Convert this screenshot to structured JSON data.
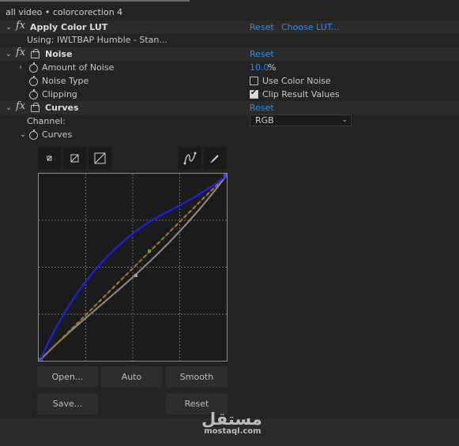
{
  "panel_title": "all video • colorcorection 4",
  "effects": {
    "apply_lut": {
      "name": "Apply Color LUT",
      "reset": "Reset",
      "choose": "Choose LUT...",
      "using": "Using: IWLTBAP Humble - Stan..."
    },
    "noise": {
      "name": "Noise",
      "reset": "Reset",
      "amount_label": "Amount of Noise",
      "amount_value": "10.0",
      "amount_unit": "%",
      "type_label": "Noise Type",
      "color_noise_label": "Use Color Noise",
      "color_noise_checked": false,
      "clipping_label": "Clipping",
      "clip_label": "Clip Result Values",
      "clip_checked": true
    },
    "curves": {
      "name": "Curves",
      "reset": "Reset",
      "channel_label": "Channel:",
      "channel_value": "RGB",
      "curves_label": "Curves",
      "buttons": {
        "open": "Open...",
        "auto": "Auto",
        "smooth": "Smooth",
        "save": "Save...",
        "reset": "Reset"
      }
    }
  },
  "fx_glyph": "fx",
  "watermark": {
    "arabic": "مستقل",
    "latin": "mostaql.com"
  },
  "colors": {
    "link": "#2d8ceb",
    "curve_blue": "#1e22d6",
    "curve_orange": "#d8732a",
    "curve_gray": "#8c8c8c"
  }
}
